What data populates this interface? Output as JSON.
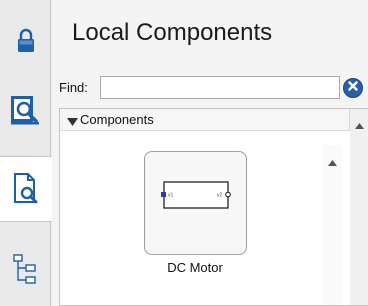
{
  "sidebar": {
    "tabs": [
      {
        "icon": "lock-icon"
      },
      {
        "icon": "library-icon"
      },
      {
        "icon": "document-search-icon",
        "active": true
      },
      {
        "icon": "hierarchy-tree-icon"
      }
    ]
  },
  "panel": {
    "title": "Local Components",
    "find": {
      "label": "Find:",
      "value": ""
    },
    "tree": {
      "section_label": "Components",
      "items": [
        {
          "label": "DC Motor",
          "icon": "dc-motor-component-icon"
        }
      ]
    }
  },
  "colors": {
    "accent": "#2b5fa8",
    "icon_blue": "#1f5fa8"
  }
}
